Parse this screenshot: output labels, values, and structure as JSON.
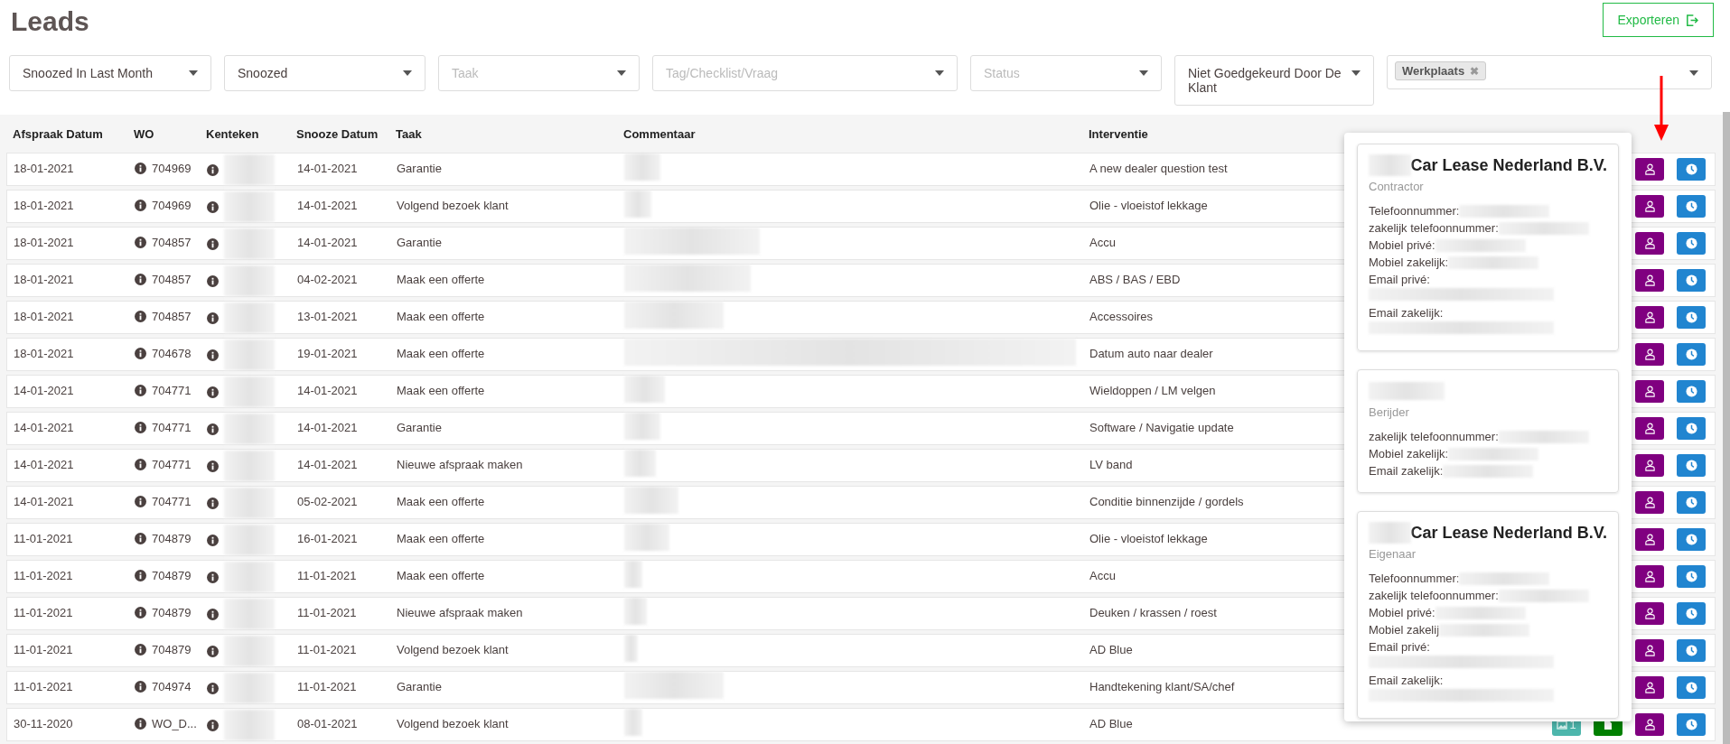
{
  "page": {
    "title": "Leads"
  },
  "export_button": {
    "label": "Exporteren"
  },
  "filters": [
    {
      "value": "Snoozed In Last Month"
    },
    {
      "value": "Snoozed"
    },
    {
      "placeholder": "Taak"
    },
    {
      "placeholder": "Tag/Checklist/Vraag"
    },
    {
      "placeholder": "Status"
    },
    {
      "value": "Niet Goedgekeurd Door De Klant"
    },
    {
      "tags": [
        {
          "label": "Werkplaats",
          "remove": "✖"
        }
      ]
    }
  ],
  "table": {
    "columns": [
      "Afspraak Datum",
      "WO",
      "Kenteken",
      "Snooze Datum",
      "Taak",
      "Commentaar",
      "Interventie"
    ],
    "rows": [
      {
        "afspraak": "18-01-2021",
        "wo": "704969",
        "snooze": "14-01-2021",
        "taak": "Garantie",
        "interventie": "A new dealer question test"
      },
      {
        "afspraak": "18-01-2021",
        "wo": "704969",
        "snooze": "14-01-2021",
        "taak": "Volgend bezoek klant",
        "interventie": "Olie - vloeistof lekkage"
      },
      {
        "afspraak": "18-01-2021",
        "wo": "704857",
        "snooze": "14-01-2021",
        "taak": "Garantie",
        "interventie": "Accu"
      },
      {
        "afspraak": "18-01-2021",
        "wo": "704857",
        "snooze": "04-02-2021",
        "taak": "Maak een offerte",
        "interventie": "ABS / BAS / EBD"
      },
      {
        "afspraak": "18-01-2021",
        "wo": "704857",
        "snooze": "13-01-2021",
        "taak": "Maak een offerte",
        "interventie": "Accessoires"
      },
      {
        "afspraak": "18-01-2021",
        "wo": "704678",
        "snooze": "19-01-2021",
        "taak": "Maak een offerte",
        "interventie": "Datum auto naar dealer"
      },
      {
        "afspraak": "14-01-2021",
        "wo": "704771",
        "snooze": "14-01-2021",
        "taak": "Maak een offerte",
        "interventie": "Wieldoppen / LM velgen"
      },
      {
        "afspraak": "14-01-2021",
        "wo": "704771",
        "snooze": "14-01-2021",
        "taak": "Garantie",
        "interventie": "Software / Navigatie update"
      },
      {
        "afspraak": "14-01-2021",
        "wo": "704771",
        "snooze": "14-01-2021",
        "taak": "Nieuwe afspraak maken",
        "interventie": "LV band"
      },
      {
        "afspraak": "14-01-2021",
        "wo": "704771",
        "snooze": "05-02-2021",
        "taak": "Maak een offerte",
        "interventie": "Conditie binnenzijde / gordels"
      },
      {
        "afspraak": "11-01-2021",
        "wo": "704879",
        "snooze": "16-01-2021",
        "taak": "Maak een offerte",
        "interventie": "Olie - vloeistof lekkage"
      },
      {
        "afspraak": "11-01-2021",
        "wo": "704879",
        "snooze": "11-01-2021",
        "taak": "Maak een offerte",
        "interventie": "Accu"
      },
      {
        "afspraak": "11-01-2021",
        "wo": "704879",
        "snooze": "11-01-2021",
        "taak": "Nieuwe afspraak maken",
        "interventie": "Deuken / krassen / roest"
      },
      {
        "afspraak": "11-01-2021",
        "wo": "704879",
        "snooze": "11-01-2021",
        "taak": "Volgend bezoek klant",
        "interventie": "AD Blue"
      },
      {
        "afspraak": "11-01-2021",
        "wo": "704974",
        "snooze": "11-01-2021",
        "taak": "Garantie",
        "interventie": "Handtekening klant/SA/chef"
      },
      {
        "afspraak": "30-11-2020",
        "wo": "WO_D...",
        "snooze": "08-01-2021",
        "taak": "Volgend bezoek klant",
        "interventie": "AD Blue",
        "photo_count": "1",
        "document": true
      }
    ]
  },
  "contact_popup": {
    "cards": [
      {
        "name": "Car Lease Nederland B.V.",
        "role": "Contractor",
        "fields": [
          {
            "label": "Telefoonnummer:",
            "kind": "inline"
          },
          {
            "label": "zakelijk telefoonnummer:",
            "kind": "inline"
          },
          {
            "label": "Mobiel privé:",
            "kind": "inline"
          },
          {
            "label": "Mobiel zakelijk:",
            "kind": "inline"
          },
          {
            "label": "Email privé:",
            "kind": "below"
          },
          {
            "label": "Email zakelijk:",
            "kind": "below"
          }
        ]
      },
      {
        "role": "Berijder",
        "fields": [
          {
            "label": "zakelijk telefoonnummer:",
            "kind": "inline"
          },
          {
            "label": "Mobiel zakelijk:",
            "kind": "inline"
          },
          {
            "label": "Email zakelijk:",
            "kind": "inline"
          }
        ]
      },
      {
        "name": "Car Lease Nederland B.V.",
        "role": "Eigenaar",
        "fields": [
          {
            "label": "Telefoonnummer:",
            "kind": "inline"
          },
          {
            "label": "zakelijk telefoonnummer:",
            "kind": "inline"
          },
          {
            "label": "Mobiel privé:",
            "kind": "inline"
          },
          {
            "label": "Mobiel zakelij",
            "kind": "inline"
          },
          {
            "label": "Email privé:",
            "kind": "below"
          },
          {
            "label": "Email zakelijk:",
            "kind": "below"
          }
        ]
      }
    ]
  }
}
